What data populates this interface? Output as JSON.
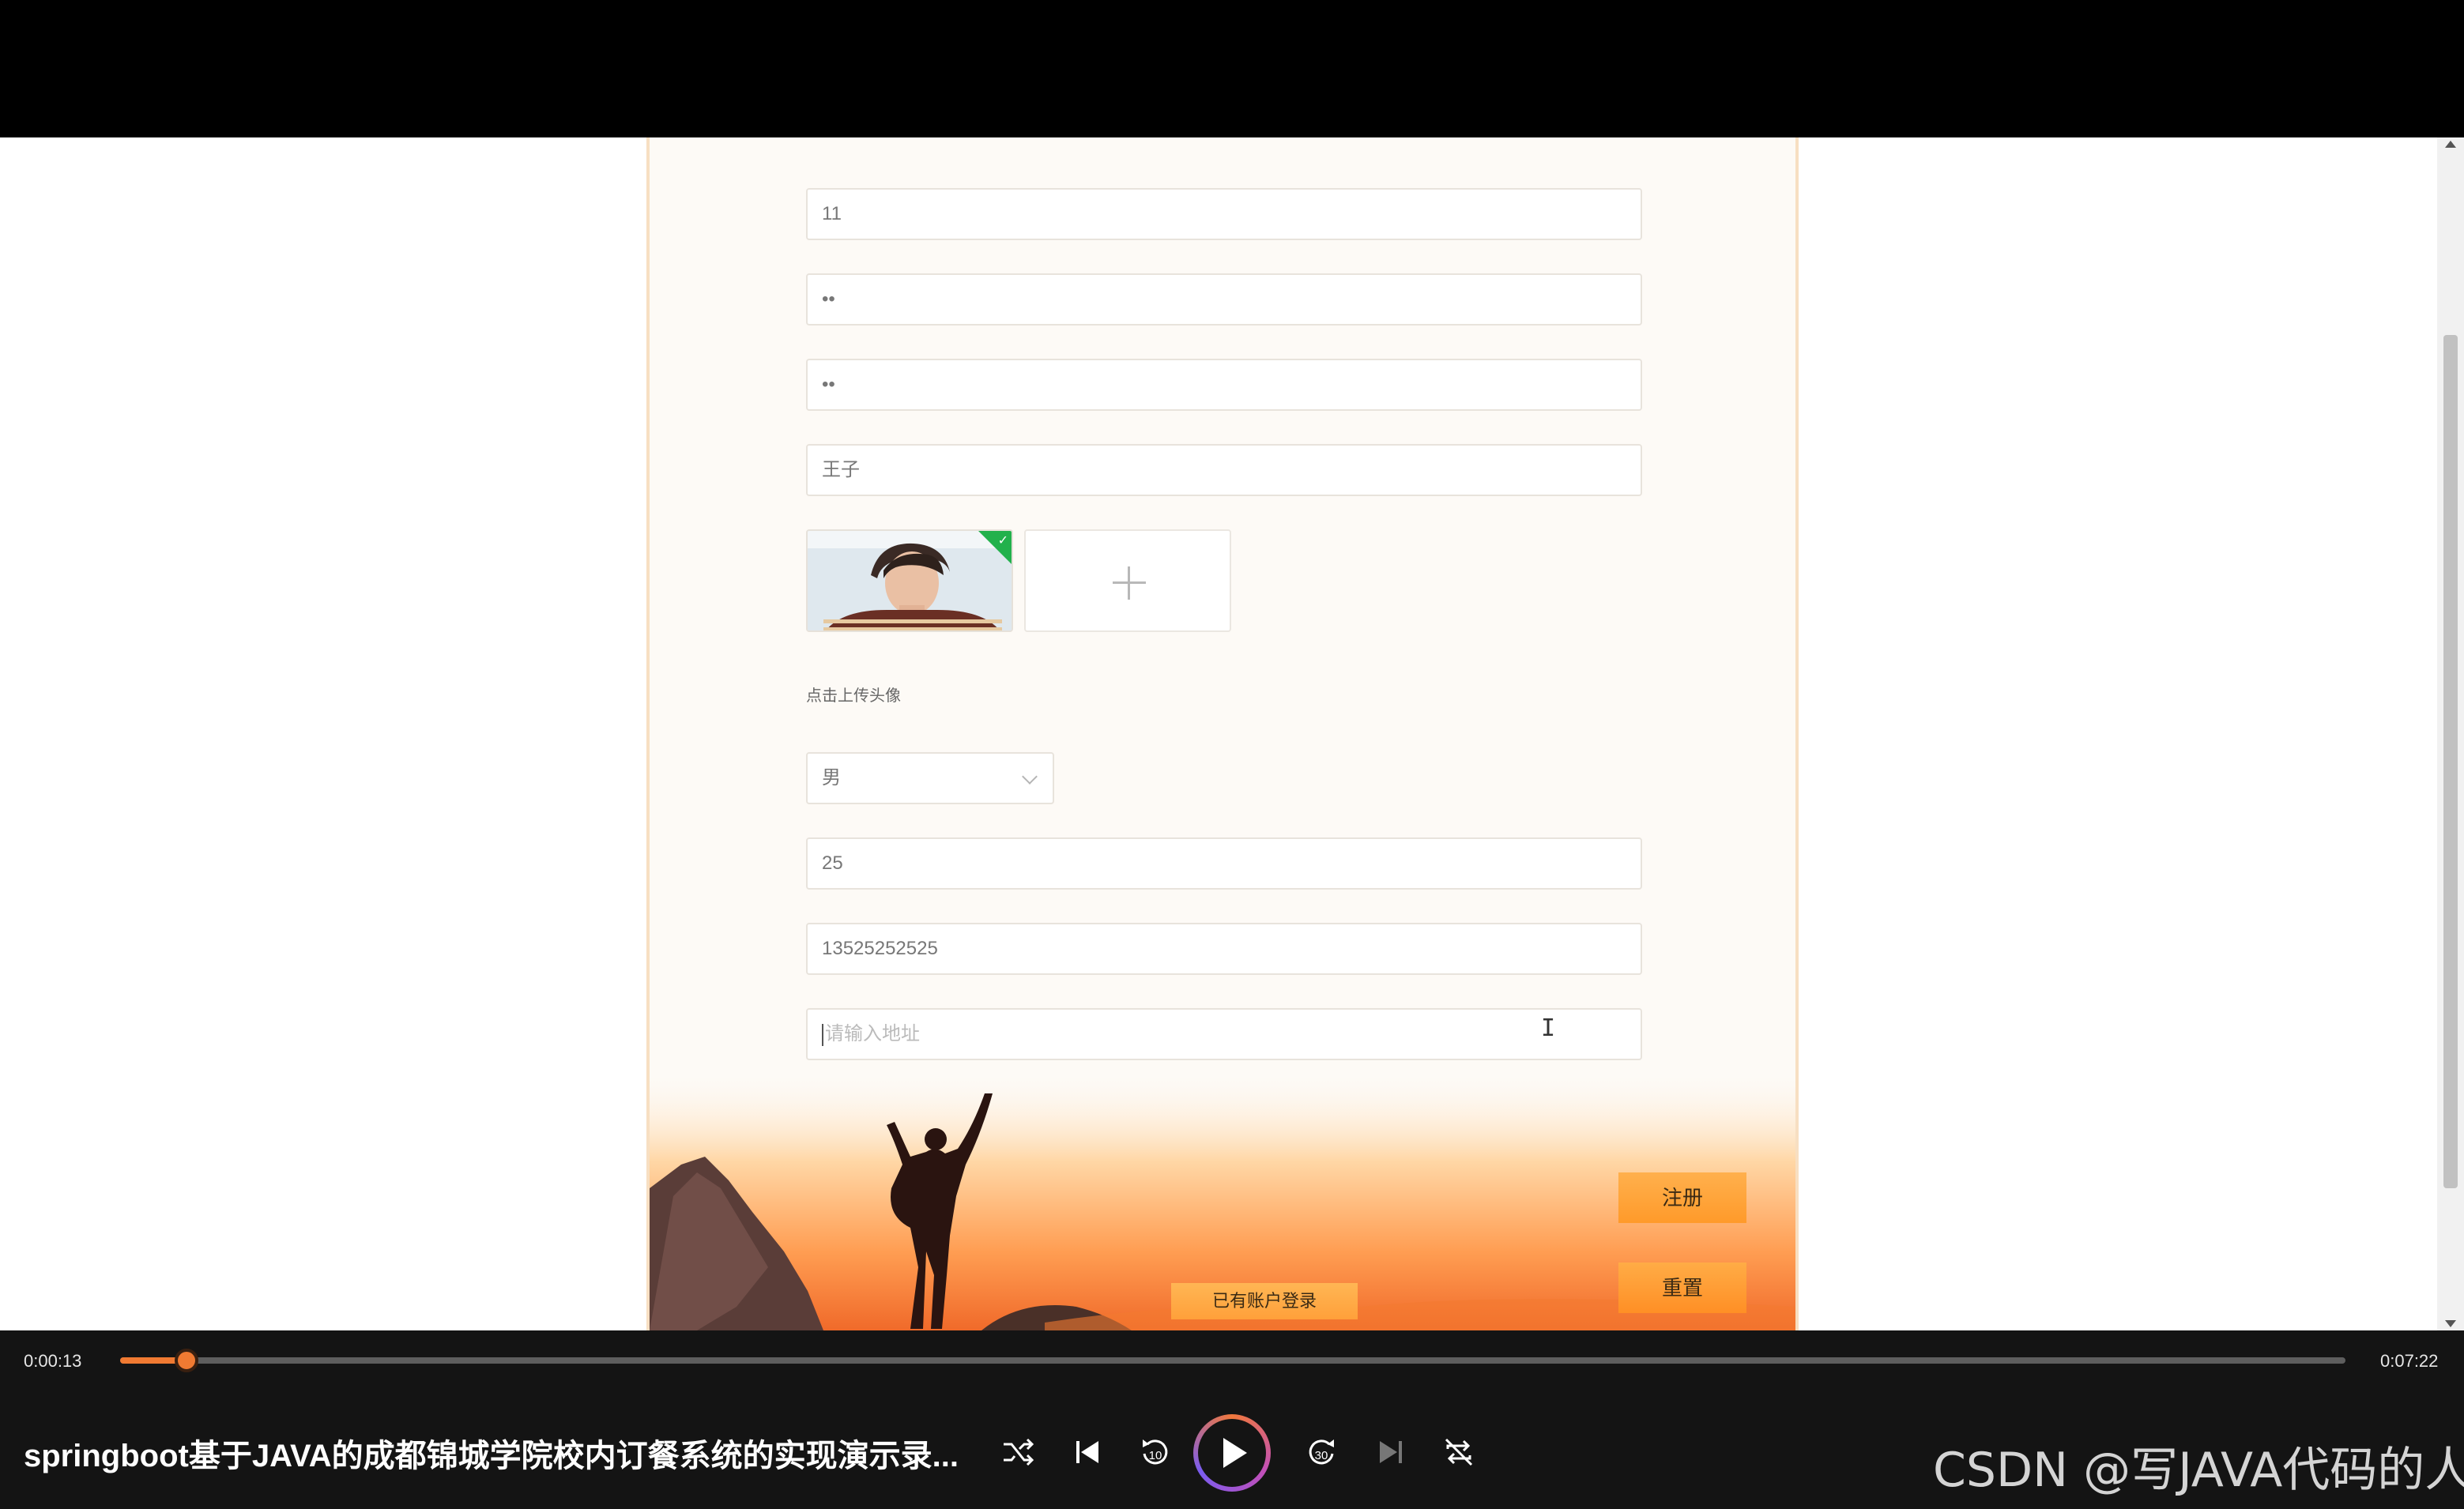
{
  "form": {
    "username_value": "11",
    "password_value": "••",
    "confirm_password_value": "••",
    "name_value": "王子",
    "upload_hint": "点击上传头像",
    "gender_selected": "男",
    "age_value": "25",
    "phone_value": "13525252525",
    "address_placeholder": "请输入地址",
    "register_label": "注册",
    "reset_label": "重置",
    "login_link_label": "已有账户登录"
  },
  "player": {
    "current_time": "0:00:13",
    "total_time": "0:07:22",
    "progress": 0.03,
    "title": "springboot基于JAVA的成都锦城学院校内订餐系统的实现演示录...",
    "accent_color": "#f07a32"
  },
  "watermark": "CSDN @写JAVA代码的人",
  "icons": {
    "shuffle": "shuffle-icon",
    "previous": "skip-previous-icon",
    "rewind": "rewind-10-icon",
    "play": "play-icon",
    "forward": "forward-30-icon",
    "next": "skip-next-icon",
    "repeat": "repeat-off-icon",
    "upload": "plus-icon"
  }
}
